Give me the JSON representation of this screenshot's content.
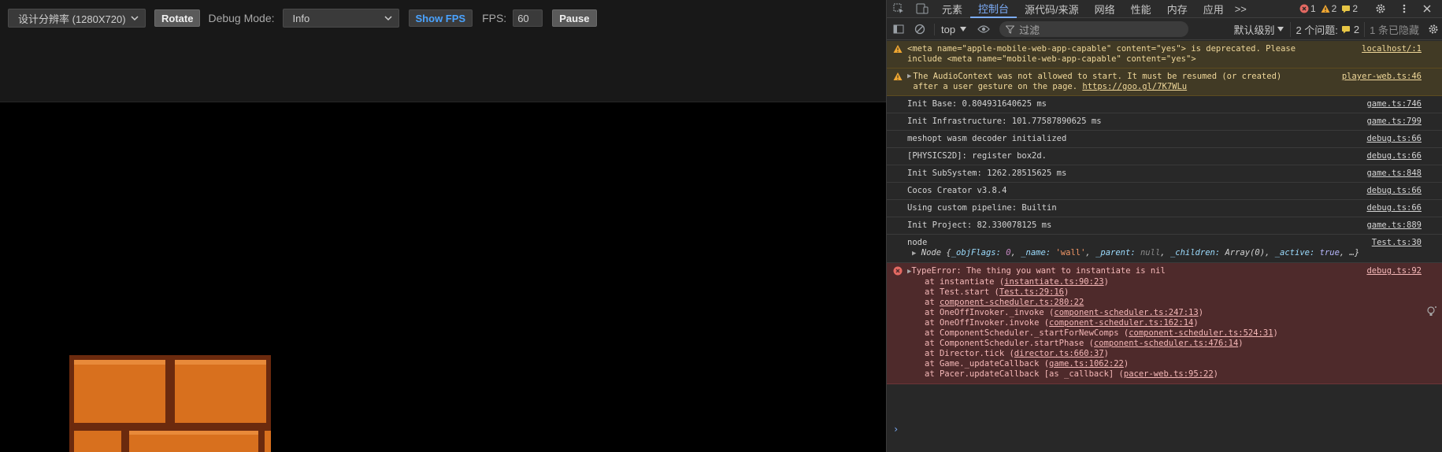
{
  "toolbar": {
    "resolution_select": "设计分辨率 (1280X720)",
    "rotate_label": "Rotate",
    "debug_mode_label": "Debug Mode:",
    "debug_mode_value": "Info",
    "show_fps_label": "Show FPS",
    "fps_label": "FPS:",
    "fps_value": "60",
    "pause_label": "Pause"
  },
  "devtools": {
    "tabs": [
      "元素",
      "控制台",
      "源代码/来源",
      "网络",
      "性能",
      "内存",
      "应用"
    ],
    "more_tabs": ">>",
    "error_count": "1",
    "warning_count": "2",
    "info_count": "2",
    "toolbar": {
      "context": "top",
      "filter_placeholder": "过滤",
      "log_level": "默认级别",
      "issues_label": "2 个问题:",
      "issues_count": "2",
      "hidden_label": "1 条已隐藏"
    }
  },
  "console": {
    "messages": [
      {
        "type": "warn",
        "text": "<meta name=\"apple-mobile-web-app-capable\" content=\"yes\"> is deprecated. Please\ninclude <meta name=\"mobile-web-app-capable\" content=\"yes\">",
        "source": "localhost/:1"
      },
      {
        "type": "warn",
        "text": "The AudioContext was not allowed to start. It must be resumed (or created)\nafter a user gesture on the page.",
        "link": "https://goo.gl/7K7WLu",
        "source": "player-web.ts:46"
      },
      {
        "type": "log",
        "text": "Init Base: 0.804931640625 ms",
        "source": "game.ts:746"
      },
      {
        "type": "log",
        "text": "Init Infrastructure: 101.77587890625 ms",
        "source": "game.ts:799"
      },
      {
        "type": "log",
        "text": "meshopt wasm decoder initialized",
        "source": "debug.ts:66"
      },
      {
        "type": "log",
        "text": "[PHYSICS2D]: register box2d.",
        "source": "debug.ts:66"
      },
      {
        "type": "log",
        "text": "Init SubSystem: 1262.28515625 ms",
        "source": "game.ts:848"
      },
      {
        "type": "log",
        "text": "Cocos Creator v3.8.4",
        "source": "debug.ts:66"
      },
      {
        "type": "log",
        "text": "Using custom pipeline: Builtin",
        "source": "debug.ts:66"
      },
      {
        "type": "log",
        "text": "Init Project: 82.330078125 ms",
        "source": "game.ts:889"
      },
      {
        "type": "log",
        "text": "node",
        "source": "Test.ts:30"
      }
    ],
    "node_object": {
      "prefix": "Node {",
      "objFlags_key": "_objFlags:",
      "objFlags_val": "0",
      "name_key": "_name:",
      "name_val": "'wall'",
      "parent_key": "_parent:",
      "parent_val": "null",
      "children_key": "_children:",
      "children_val": "Array(0)",
      "active_key": "_active:",
      "active_val": "true",
      "suffix": "…}"
    },
    "error": {
      "headline": "TypeError: The thing you want to instantiate is nil",
      "source": "debug.ts:92",
      "stack": [
        {
          "pre": "at instantiate (",
          "link": "instantiate.ts:90:23",
          "post": ")"
        },
        {
          "pre": "at Test.start (",
          "link": "Test.ts:29:16",
          "post": ")"
        },
        {
          "pre": "at ",
          "link": "component-scheduler.ts:280:22",
          "post": ""
        },
        {
          "pre": "at OneOffInvoker._invoke (",
          "link": "component-scheduler.ts:247:13",
          "post": ")"
        },
        {
          "pre": "at OneOffInvoker.invoke (",
          "link": "component-scheduler.ts:162:14",
          "post": ")"
        },
        {
          "pre": "at ComponentScheduler._startForNewComps (",
          "link": "component-scheduler.ts:524:31",
          "post": ")"
        },
        {
          "pre": "at ComponentScheduler.startPhase (",
          "link": "component-scheduler.ts:476:14",
          "post": ")"
        },
        {
          "pre": "at Director.tick (",
          "link": "director.ts:660:37",
          "post": ")"
        },
        {
          "pre": "at Game._updateCallback (",
          "link": "game.ts:1062:22",
          "post": ")"
        },
        {
          "pre": "at Pacer.updateCallback [as _callback] (",
          "link": "pacer-web.ts:95:22",
          "post": ")"
        }
      ]
    },
    "prompt": "›"
  },
  "colors": {
    "accent": "#7cacf8",
    "show_fps": "#4aa3ff",
    "brick": "#d8701e",
    "mortar": "#6b2a0e"
  }
}
